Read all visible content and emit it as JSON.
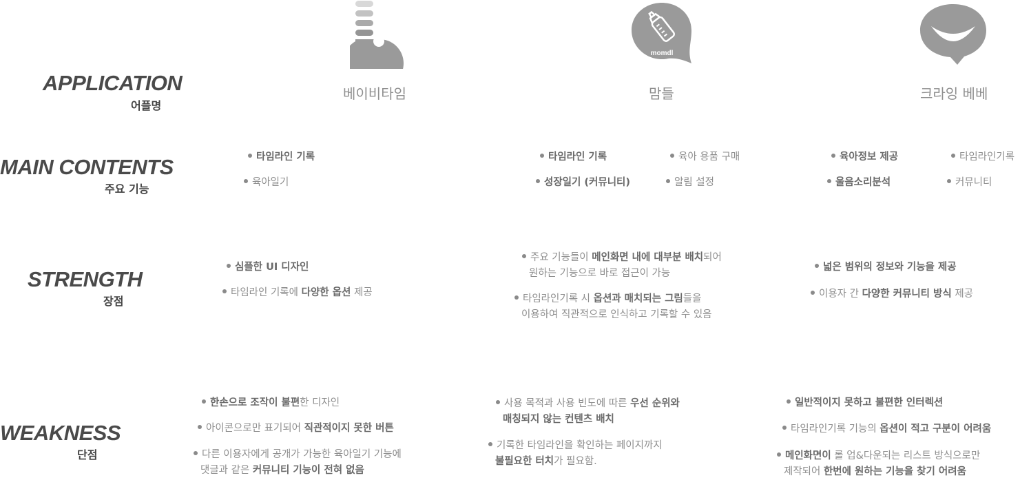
{
  "rows": {
    "application": {
      "title": "APPLICATION",
      "sub": "어플명"
    },
    "main_contents": {
      "title": "MAIN CONTENTS",
      "sub": "주요 기능"
    },
    "strength": {
      "title": "STRENGTH",
      "sub": "장점"
    },
    "weakness": {
      "title": "WEAKNESS",
      "sub": "단점"
    }
  },
  "apps": [
    {
      "name": "베이비타임",
      "icon": "babytime-logo-icon"
    },
    {
      "name": "맘들",
      "icon": "momdl-bottle-logo-icon",
      "logo_text": "momdl"
    },
    {
      "name": "크라잉 베베",
      "icon": "cryingbebe-smile-logo-icon"
    }
  ],
  "main_contents": {
    "babytime": [
      "타임라인 기록",
      "육아일기"
    ],
    "momdl": [
      "타임라인 기록",
      "육아 용품 구매",
      "성장일기 (커뮤니티)",
      "알림 설정"
    ],
    "cryingbebe": [
      "육아정보 제공",
      "타임라인기록",
      "울음소리분석",
      "커뮤니티"
    ]
  },
  "strength": {
    "babytime": {
      "s1": "심플한 UI 디자인",
      "s2_a": "타임라인 기록에 ",
      "s2_b": "다양한 옵션",
      "s2_c": " 제공"
    },
    "momdl": {
      "s1_a": "주요 기능들이 ",
      "s1_b": "메인화면 내에 대부분 배치",
      "s1_c": "되어",
      "s1_d": "원하는 기능으로 바로 접근이 가능",
      "s2_a": "타임라인기록 시 ",
      "s2_b": "옵션과 매치되는 그림",
      "s2_c": "들을",
      "s2_d": "이용하여 직관적으로 인식하고 기록할 수 있음"
    },
    "cryingbebe": {
      "s1": "넓은 범위의 정보와 기능을 제공",
      "s2_a": "이용자 간 ",
      "s2_b": "다양한 커뮤니티 방식",
      "s2_c": " 제공"
    }
  },
  "weakness": {
    "babytime": {
      "w1_a": "한손으로 조작이 불편",
      "w1_b": "한 디자인",
      "w2_a": "아이콘으로만 표기되어 ",
      "w2_b": "직관적이지 못한 버튼",
      "w3_a": "다른 이용자에게 공개가 가능한 육아일기 기능에",
      "w3_b": "댓글과 같은 ",
      "w3_c": "커뮤니티 기능이 전혀 없음"
    },
    "momdl": {
      "w1_a": "사용 목적과 사용 빈도에 따른 ",
      "w1_b": "우선 순위와",
      "w1_c": "매칭되지 않는 컨텐츠 배치",
      "w2_a": "기록한 타임라인을 확인하는 페이지까지",
      "w2_b": "불필요한 터치",
      "w2_c": "가 필요함."
    },
    "cryingbebe": {
      "w1": "일반적이지 못하고 불편한 인터렉션",
      "w2_a": "타임라인기록 기능의 ",
      "w2_b": "옵션이 적고 구분이 어려움",
      "w3_a": "메인화면이",
      "w3_b": " 롤 업&다운되는 리스트 방식으로만",
      "w3_c": "제작되어 ",
      "w3_d": "한번에 원하는 기능을 찾기 어려움"
    }
  },
  "colors": {
    "text_dark": "#4a4a4a",
    "text_mid": "#6a6a6a",
    "text_light": "#8e8e8e",
    "icon_gray": "#9a9a9a"
  }
}
